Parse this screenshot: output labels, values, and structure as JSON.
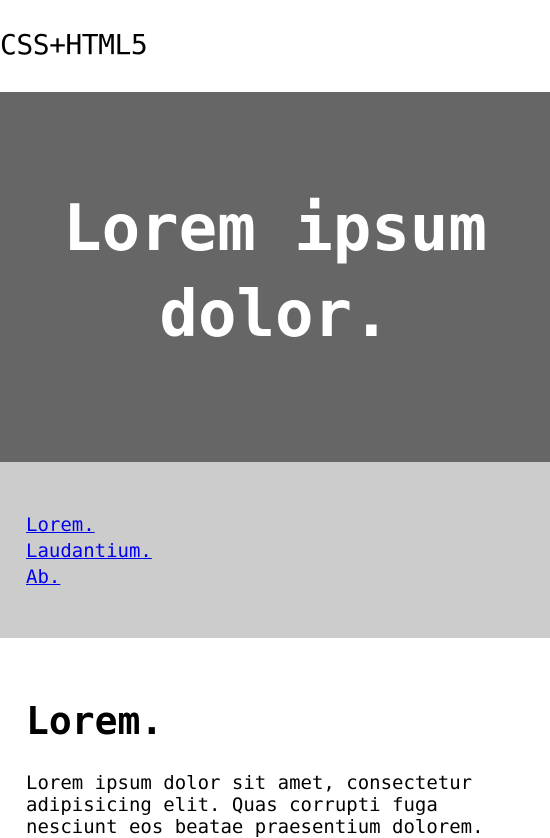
{
  "header": {
    "logo": "CSS+HTML5"
  },
  "hero": {
    "title": "Lorem ipsum dolor."
  },
  "nav": {
    "links": [
      {
        "label": "Lorem."
      },
      {
        "label": "Laudantium."
      },
      {
        "label": "Ab."
      }
    ]
  },
  "content": {
    "heading": "Lorem.",
    "paragraph": "Lorem ipsum dolor sit amet, consectetur adipisicing elit. Quas corrupti fuga nesciunt eos beatae praesentium dolorem."
  },
  "colors": {
    "hero_background": "#666666",
    "nav_background": "#cccccc",
    "link": "#0000ee"
  }
}
